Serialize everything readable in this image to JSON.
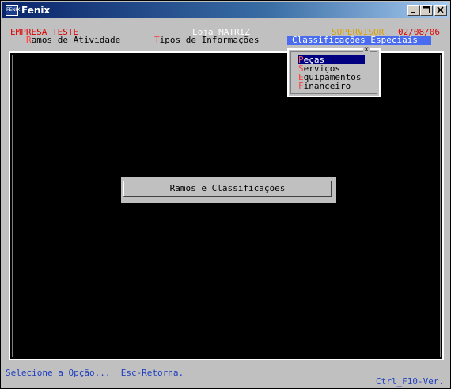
{
  "window": {
    "title": "Fenix",
    "icon_text": "FENIX"
  },
  "header": {
    "company": "EMPRESA TESTE",
    "store": "Loja MATRIZ",
    "user": "SUPERVISOR",
    "date": "02/08/06"
  },
  "menubar": {
    "items": [
      {
        "hot": "R",
        "rest": "amos de Atividade"
      },
      {
        "hot": "T",
        "rest": "ipos de Informações"
      },
      {
        "label": "Classificações Especiais"
      }
    ]
  },
  "submenu": {
    "close_mark": "x",
    "items": [
      {
        "hot": "P",
        "rest": "eças"
      },
      {
        "hot": "S",
        "rest": "erviços"
      },
      {
        "hot": "E",
        "rest": "quipamentos"
      },
      {
        "hot": "F",
        "rest": "inanceiro"
      }
    ]
  },
  "dialog": {
    "label": "Ramos e Classificações"
  },
  "footer": {
    "status": "Selecione a Opção...  Esc-Retorna.",
    "version": "Ctrl_F10-Ver."
  },
  "colors": {
    "company": "#e00000",
    "date": "#e00000",
    "user": "#d8a000",
    "status": "#2040c0",
    "active_menu": "#4a6df0",
    "selected_item": "#000080"
  }
}
